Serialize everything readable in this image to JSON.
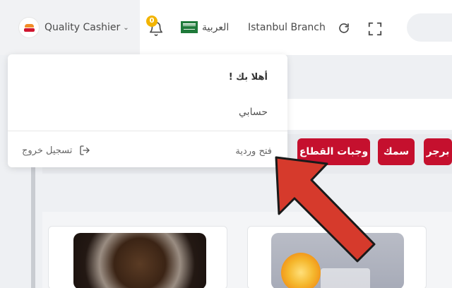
{
  "header": {
    "user_name": "Quality Cashier",
    "notification_count": "0",
    "language_label": "العربية",
    "branch_name": "Istanbul Branch"
  },
  "dropdown": {
    "greeting": "أهلا بك !",
    "account": "حسابي",
    "open_shift": "فتح وردية",
    "logout": "تسجيل خروج"
  },
  "categories": {
    "burger": "برجر",
    "fish": "سمك",
    "meals": "وجبات القطاع"
  },
  "colors": {
    "category_red": "#c5102e",
    "badge_yellow": "#f2b400",
    "annotation_red": "#d63a2c"
  },
  "icons": [
    "bell-icon",
    "saudi-flag-icon",
    "refresh-icon",
    "fullscreen-icon",
    "logout-icon",
    "chevron-down-icon"
  ]
}
